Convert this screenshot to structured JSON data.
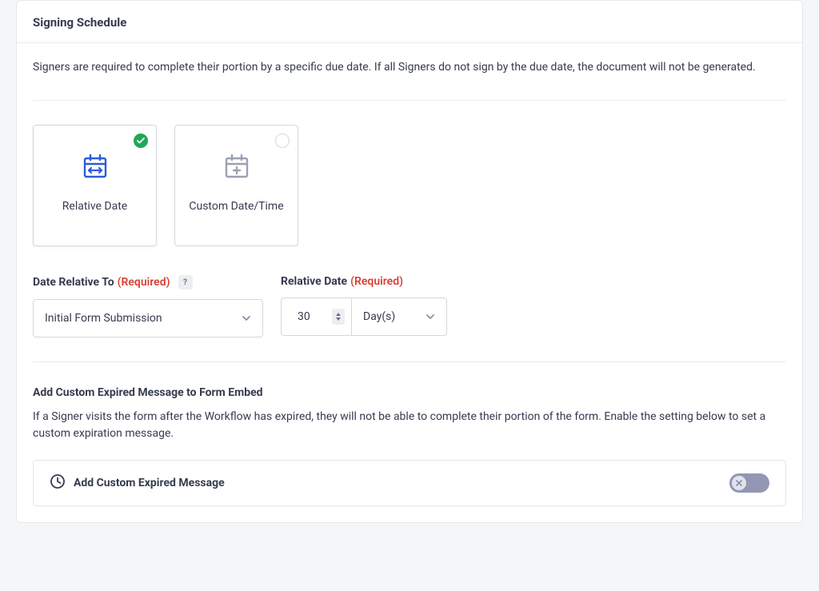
{
  "header": {
    "title": "Signing Schedule"
  },
  "description": "Signers are required to complete their portion by a specific due date. If all Signers do not sign by the due date, the document will not be generated.",
  "options": {
    "relative": {
      "label": "Relative Date",
      "selected": true
    },
    "custom": {
      "label": "Custom Date/Time",
      "selected": false
    }
  },
  "fields": {
    "date_relative_to": {
      "label": "Date Relative To",
      "required_text": "(Required)",
      "help_badge": "?",
      "value": "Initial Form Submission"
    },
    "relative_date": {
      "label": "Relative Date",
      "required_text": "(Required)",
      "number_value": "30",
      "unit_value": "Day(s)"
    }
  },
  "custom_expired": {
    "title": "Add Custom Expired Message to Form Embed",
    "desc": "If a Signer visits the form after the Workflow has expired, they will not be able to complete their portion of the form. Enable the setting below to set a custom expiration message.",
    "toggle_label": "Add Custom Expired Message",
    "enabled": false
  },
  "colors": {
    "accent_blue": "#2b5cd9",
    "success_green": "#21a756",
    "required_red": "#d93f34",
    "toggle_off": "#9397b4"
  }
}
